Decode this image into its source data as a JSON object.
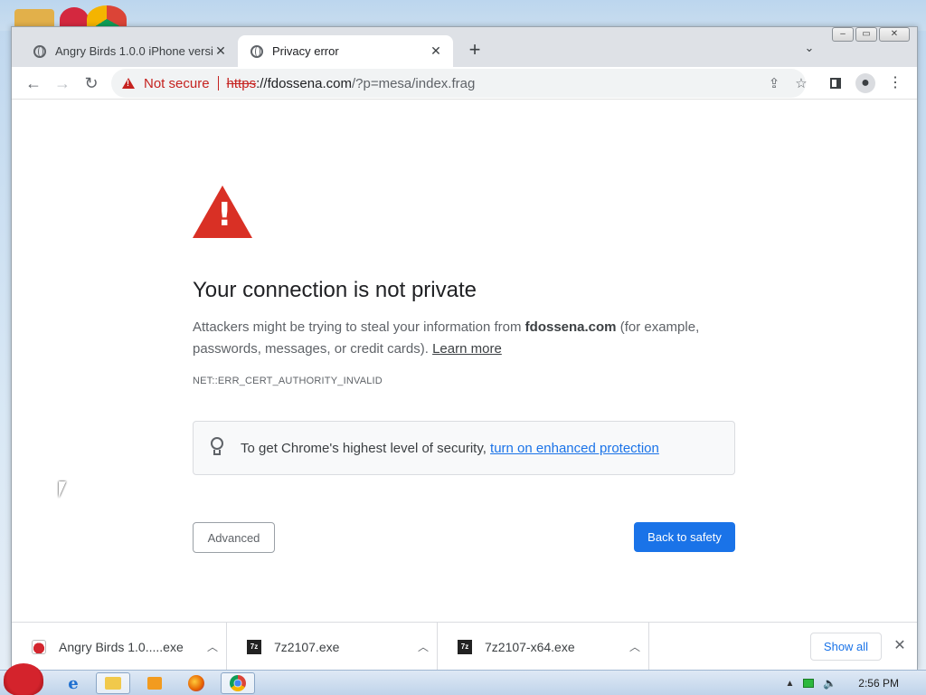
{
  "browser": {
    "tabs": [
      {
        "title": "Angry Birds 1.0.0 iPhone versio",
        "active": false
      },
      {
        "title": "Privacy error",
        "active": true
      }
    ],
    "new_tab_label": "+",
    "tab_search_icon": "chevron-down-icon",
    "omnibox": {
      "security_label": "Not secure",
      "url_scheme": "https",
      "url_host": "://fdossena.com",
      "url_path": "/?p=mesa/index.frag"
    }
  },
  "interstitial": {
    "heading": "Your connection is not private",
    "explain_prefix": "Attackers might be trying to steal your information from ",
    "explain_domain": "fdossena.com",
    "explain_suffix": " (for example, passwords, messages, or credit cards). ",
    "learn_more": "Learn more",
    "error_code": "NET::ERR_CERT_AUTHORITY_INVALID",
    "callout_text": "To get Chrome's highest level of security, ",
    "callout_link": "turn on enhanced protection",
    "advanced_button": "Advanced",
    "safety_button": "Back to safety"
  },
  "downloads": {
    "items": [
      {
        "name": "Angry Birds 1.0.....exe",
        "icon": "angry-bird-icon"
      },
      {
        "name": "7z2107.exe",
        "icon": "7z-icon"
      },
      {
        "name": "7z2107-x64.exe",
        "icon": "7z-icon"
      }
    ],
    "show_all": "Show all"
  },
  "taskbar": {
    "clock": "2:56 PM"
  },
  "colors": {
    "danger": "#d93025",
    "accent": "#1a73e8"
  }
}
